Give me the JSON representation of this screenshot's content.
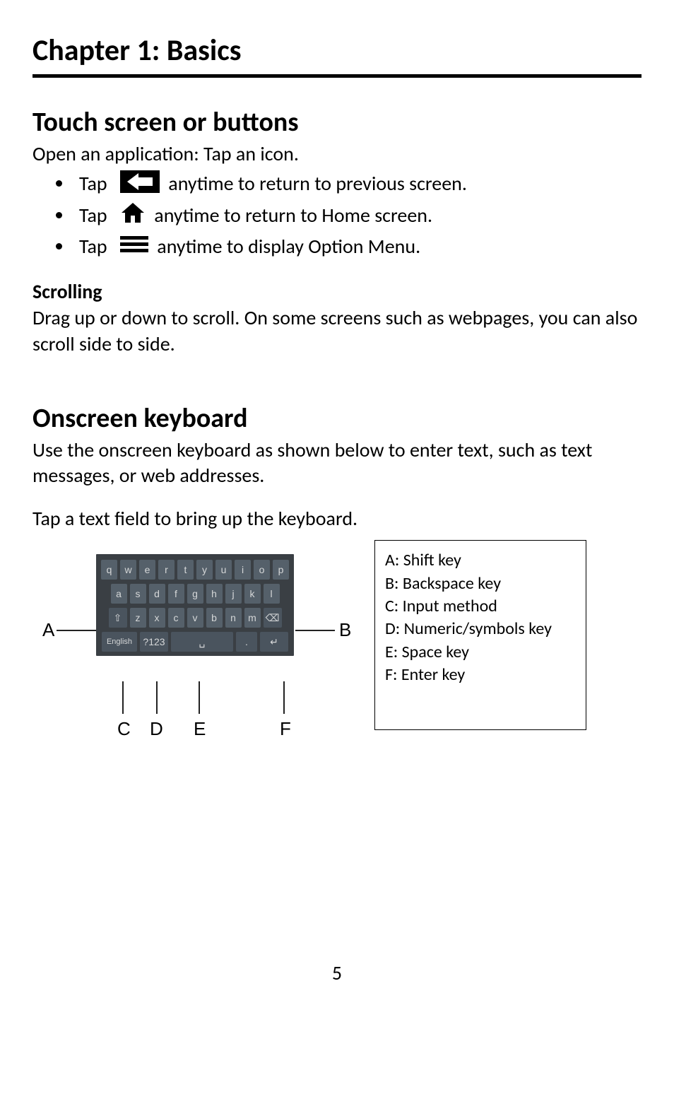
{
  "chapter": {
    "title": "Chapter 1: Basics"
  },
  "section1": {
    "title": "Touch screen or buttons",
    "intro": "Open an application: Tap an icon.",
    "bullets": [
      {
        "pre": "Tap",
        "icon": "back-arrow-icon",
        "post": "anytime to return to previous screen."
      },
      {
        "pre": "Tap",
        "icon": "home-icon",
        "post": "anytime to return to Home screen."
      },
      {
        "pre": "Tap",
        "icon": "menu-lines-icon",
        "post": "anytime to display Option Menu."
      }
    ],
    "scrolling": {
      "heading": "Scrolling",
      "text": "Drag up or down to scroll. On some screens such as webpages, you can also scroll side to side."
    }
  },
  "section2": {
    "title": "Onscreen keyboard",
    "text": "Use the onscreen keyboard as shown below to enter text, such as text messages, or web addresses.",
    "tap_text": "Tap a text field to bring up the keyboard.",
    "keyboard": {
      "row1": [
        "q",
        "w",
        "e",
        "r",
        "t",
        "y",
        "u",
        "i",
        "o",
        "p"
      ],
      "row2": [
        "a",
        "s",
        "d",
        "f",
        "g",
        "h",
        "j",
        "k",
        "l"
      ],
      "row3_shift": "⇧",
      "row3": [
        "z",
        "x",
        "c",
        "v",
        "b",
        "n",
        "m"
      ],
      "row3_bksp": "⌫",
      "row4_lang": "English",
      "row4_num": "?123",
      "row4_space": "␣",
      "row4_dot": ".",
      "row4_enter": "↵"
    },
    "legend": {
      "A": "A:  Shift key",
      "B": "B:  Backspace key",
      "C": "C: Input method",
      "D": "D: Numeric/symbols key",
      "E": "E:  Space key",
      "F": "F: Enter key"
    },
    "callouts": {
      "A": "A",
      "B": "B",
      "C": "C",
      "D": "D",
      "E": "E",
      "F": "F"
    }
  },
  "page_number": "5"
}
